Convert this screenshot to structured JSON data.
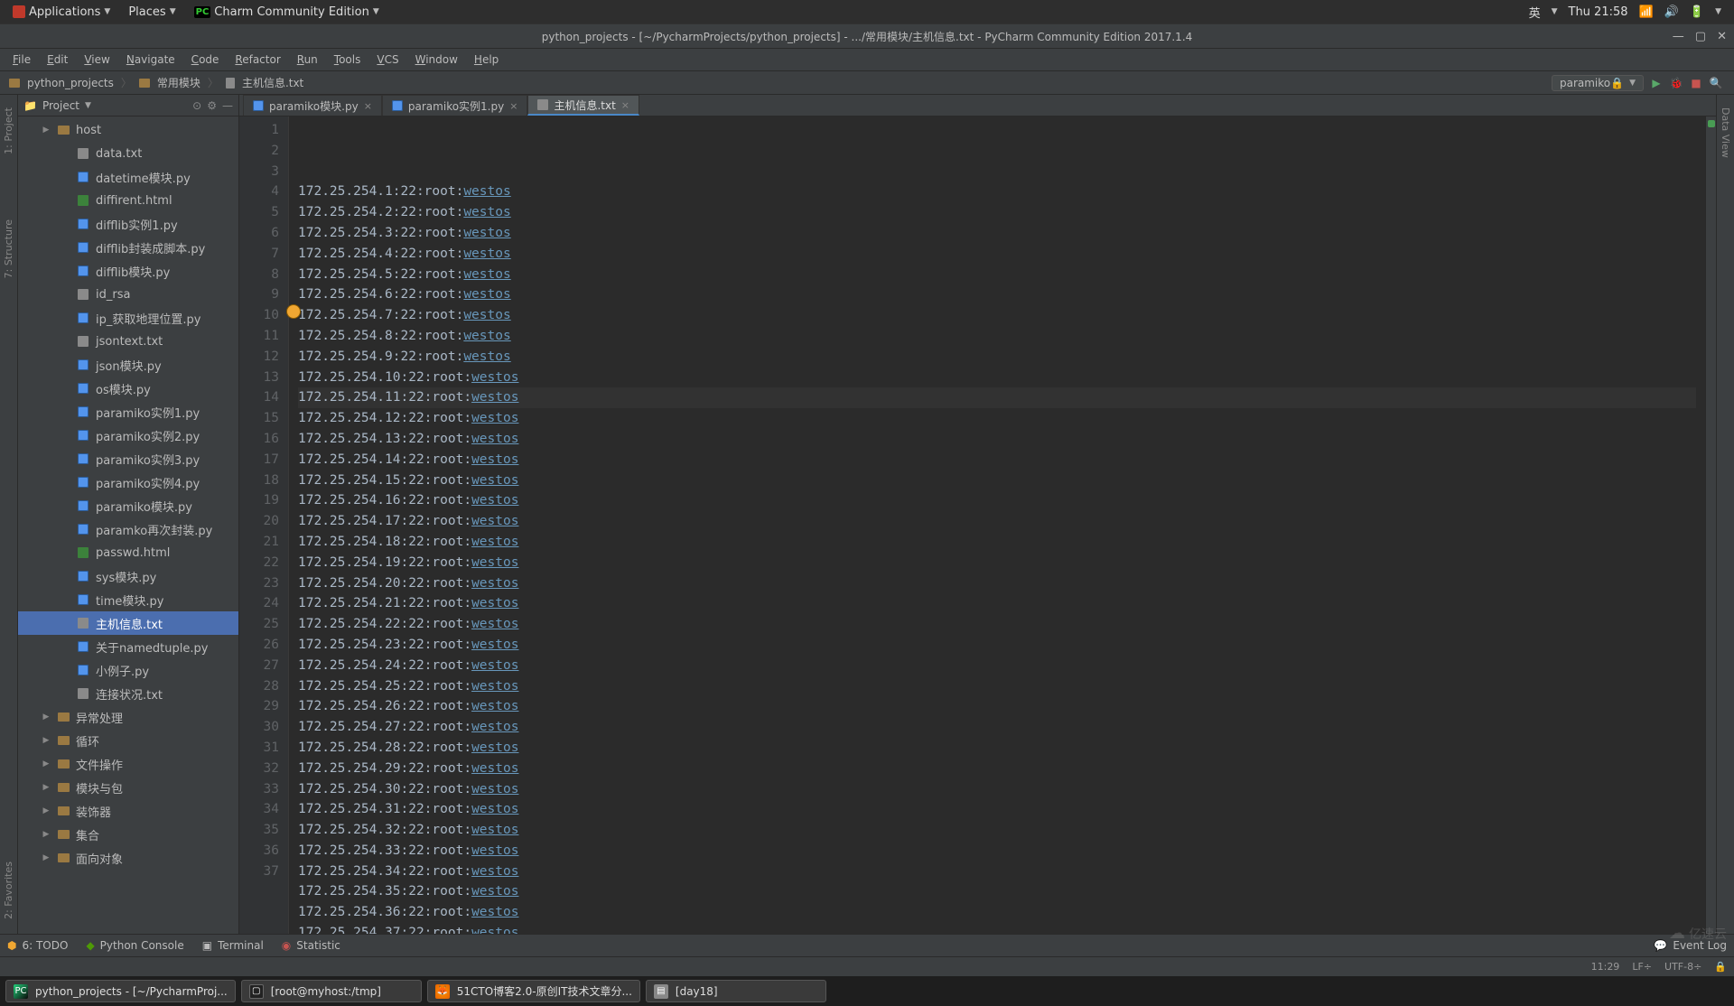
{
  "gnome": {
    "applications": "Applications",
    "places": "Places",
    "app_indicator": "Charm Community Edition",
    "input_method": "英",
    "clock": "Thu 21:58"
  },
  "window": {
    "title": "python_projects - [~/PycharmProjects/python_projects] - .../常用模块/主机信息.txt - PyCharm Community Edition 2017.1.4"
  },
  "menus": [
    "File",
    "Edit",
    "View",
    "Navigate",
    "Code",
    "Refactor",
    "Run",
    "Tools",
    "VCS",
    "Window",
    "Help"
  ],
  "breadcrumb": {
    "root": "python_projects",
    "folder": "常用模块",
    "file": "主机信息.txt"
  },
  "run_config": "paramiko🔒",
  "project": {
    "title": "Project",
    "items": [
      {
        "type": "folder",
        "label": "host",
        "indent": 1,
        "arrow": "▶"
      },
      {
        "type": "txt",
        "label": "data.txt",
        "indent": 2
      },
      {
        "type": "py",
        "label": "datetime模块.py",
        "indent": 2
      },
      {
        "type": "html",
        "label": "diffirent.html",
        "indent": 2
      },
      {
        "type": "py",
        "label": "difflib实例1.py",
        "indent": 2
      },
      {
        "type": "py",
        "label": "difflib封装成脚本.py",
        "indent": 2
      },
      {
        "type": "py",
        "label": "difflib模块.py",
        "indent": 2
      },
      {
        "type": "txt",
        "label": "id_rsa",
        "indent": 2
      },
      {
        "type": "py",
        "label": "ip_获取地理位置.py",
        "indent": 2
      },
      {
        "type": "txt",
        "label": "jsontext.txt",
        "indent": 2
      },
      {
        "type": "py",
        "label": "json模块.py",
        "indent": 2
      },
      {
        "type": "py",
        "label": "os模块.py",
        "indent": 2
      },
      {
        "type": "py",
        "label": "paramiko实例1.py",
        "indent": 2
      },
      {
        "type": "py",
        "label": "paramiko实例2.py",
        "indent": 2
      },
      {
        "type": "py",
        "label": "paramiko实例3.py",
        "indent": 2
      },
      {
        "type": "py",
        "label": "paramiko实例4.py",
        "indent": 2
      },
      {
        "type": "py",
        "label": "paramiko模块.py",
        "indent": 2
      },
      {
        "type": "py",
        "label": "paramko再次封装.py",
        "indent": 2
      },
      {
        "type": "html",
        "label": "passwd.html",
        "indent": 2
      },
      {
        "type": "py",
        "label": "sys模块.py",
        "indent": 2
      },
      {
        "type": "py",
        "label": "time模块.py",
        "indent": 2
      },
      {
        "type": "txt",
        "label": "主机信息.txt",
        "indent": 2,
        "selected": true
      },
      {
        "type": "py",
        "label": "关于namedtuple.py",
        "indent": 2
      },
      {
        "type": "py",
        "label": "小例子.py",
        "indent": 2
      },
      {
        "type": "txt",
        "label": "连接状况.txt",
        "indent": 2
      },
      {
        "type": "folder",
        "label": "异常处理",
        "indent": 1,
        "arrow": "▶"
      },
      {
        "type": "folder",
        "label": "循环",
        "indent": 1,
        "arrow": "▶"
      },
      {
        "type": "folder",
        "label": "文件操作",
        "indent": 1,
        "arrow": "▶"
      },
      {
        "type": "folder",
        "label": "模块与包",
        "indent": 1,
        "arrow": "▶"
      },
      {
        "type": "folder",
        "label": "装饰器",
        "indent": 1,
        "arrow": "▶"
      },
      {
        "type": "folder",
        "label": "集合",
        "indent": 1,
        "arrow": "▶"
      },
      {
        "type": "folder",
        "label": "面向对象",
        "indent": 1,
        "arrow": "▶"
      }
    ]
  },
  "tabs": [
    {
      "label": "paramiko模块.py",
      "icon": "py"
    },
    {
      "label": "paramiko实例1.py",
      "icon": "py"
    },
    {
      "label": "主机信息.txt",
      "icon": "txt",
      "active": true
    }
  ],
  "editor": {
    "prefix": "172.25.254.",
    "mid": ":22:root:",
    "pwd": "westos",
    "line_count": 37,
    "current_line": 11
  },
  "left_tabs": {
    "project": "1: Project",
    "structure": "7: Structure",
    "favorites": "2: Favorites"
  },
  "right_tabs": {
    "dataview": "Data View"
  },
  "bottom_tools": {
    "todo": "6: TODO",
    "python_console": "Python Console",
    "terminal": "Terminal",
    "statistic": "Statistic",
    "event_log": "Event Log"
  },
  "status": {
    "pos": "11:29",
    "sep": "LF÷",
    "enc": "UTF-8÷",
    "lock": "🔒"
  },
  "taskbar": [
    {
      "icon": "pc",
      "label": "python_projects - [~/PycharmProj..."
    },
    {
      "icon": "term",
      "label": "[root@myhost:/tmp]"
    },
    {
      "icon": "ff",
      "label": "51CTO博客2.0-原创IT技术文章分..."
    },
    {
      "icon": "file",
      "label": "[day18]"
    }
  ],
  "watermark": "亿速云"
}
